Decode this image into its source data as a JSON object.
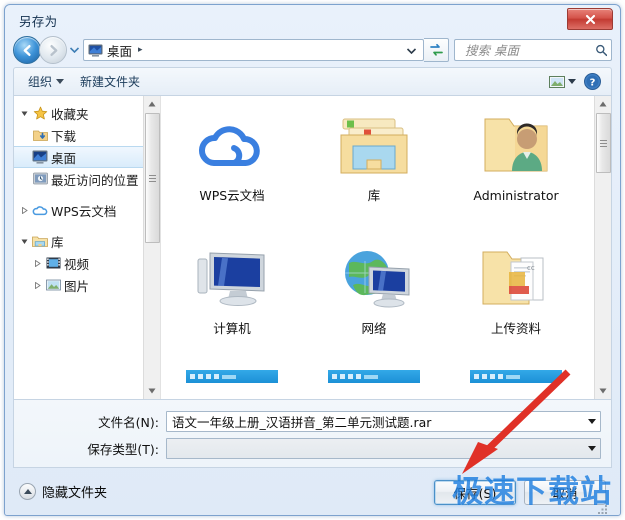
{
  "window": {
    "title": "另存为",
    "close_label": "关闭",
    "close_icon": "close-icon"
  },
  "nav": {
    "back_icon": "back-arrow-icon",
    "forward_icon": "forward-arrow-icon",
    "recent_icon": "chevron-down-icon",
    "address_icon": "desktop-icon",
    "address_text": "桌面",
    "crumb_separator": "▸",
    "address_dropdown_icon": "chevron-down-icon",
    "refresh_icon": "refresh-icon",
    "search_placeholder": "搜索 桌面",
    "search_value": "",
    "search_icon": "search-icon"
  },
  "toolbar": {
    "organize_label": "组织",
    "organize_icon": "chevron-down-icon",
    "new_folder_label": "新建文件夹",
    "view_icon": "view-mode-icon",
    "view_dropdown_icon": "chevron-down-icon",
    "help_icon": "help-icon",
    "help_label": "?"
  },
  "sidebar": {
    "items": [
      {
        "label": "收藏夹",
        "icon": "star-icon",
        "indent": 1,
        "twisty": "expanded",
        "selected": false
      },
      {
        "label": "下载",
        "icon": "downloads-icon",
        "indent": 2,
        "twisty": "none",
        "selected": false
      },
      {
        "label": "桌面",
        "icon": "desktop-icon",
        "indent": 2,
        "twisty": "none",
        "selected": true
      },
      {
        "label": "最近访问的位置",
        "icon": "recent-places-icon",
        "indent": 2,
        "twisty": "none",
        "selected": false
      },
      {
        "label": "WPS云文档",
        "icon": "cloud-icon",
        "indent": 1,
        "twisty": "collapsed",
        "selected": false
      },
      {
        "label": "库",
        "icon": "library-icon",
        "indent": 1,
        "twisty": "expanded",
        "selected": false
      },
      {
        "label": "视频",
        "icon": "video-icon",
        "indent": 2,
        "twisty": "collapsed",
        "selected": false
      },
      {
        "label": "图片",
        "icon": "pictures-icon",
        "indent": 2,
        "twisty": "collapsed",
        "selected": false
      }
    ],
    "scrollbar": {
      "up_icon": "scroll-up-icon",
      "down_icon": "scroll-down-icon",
      "thumb_top_pct": 4,
      "thumb_height_pct": 46
    }
  },
  "filelist": {
    "items": [
      {
        "label": "WPS云文档",
        "icon": "cloud-icon"
      },
      {
        "label": "库",
        "icon": "library-folder-icon"
      },
      {
        "label": "Administrator",
        "icon": "user-folder-icon"
      },
      {
        "label": "计算机",
        "icon": "computer-icon"
      },
      {
        "label": "网络",
        "icon": "network-icon"
      },
      {
        "label": "上传资料",
        "icon": "documents-folder-icon"
      },
      {
        "label": "",
        "icon": "screenshot-thumb-icon"
      },
      {
        "label": "",
        "icon": "screenshot-thumb-icon"
      },
      {
        "label": "",
        "icon": "screenshot-thumb-icon"
      }
    ],
    "scrollbar": {
      "up_icon": "scroll-up-icon",
      "down_icon": "scroll-down-icon",
      "thumb_top_pct": 3,
      "thumb_height_pct": 19
    }
  },
  "form": {
    "filename_label": "文件名(N):",
    "filename_value": "语文一年级上册_汉语拼音_第二单元测试题.rar",
    "filename_dropdown_icon": "chevron-down-icon",
    "filetype_label": "保存类型(T):",
    "filetype_value": "",
    "filetype_dropdown_icon": "chevron-down-icon"
  },
  "footer": {
    "hide_folders_label": "隐藏文件夹",
    "hide_folders_icon": "chevron-up-circle-icon",
    "save_label": "保存(S)",
    "cancel_label": "取消",
    "resize_icon": "resize-grip-icon"
  },
  "annotation": {
    "arrow_icon": "red-arrow-icon",
    "arrow_color": "#e03127",
    "watermark_text": "极速下载站",
    "watermark_color": "#1f7fe0"
  }
}
